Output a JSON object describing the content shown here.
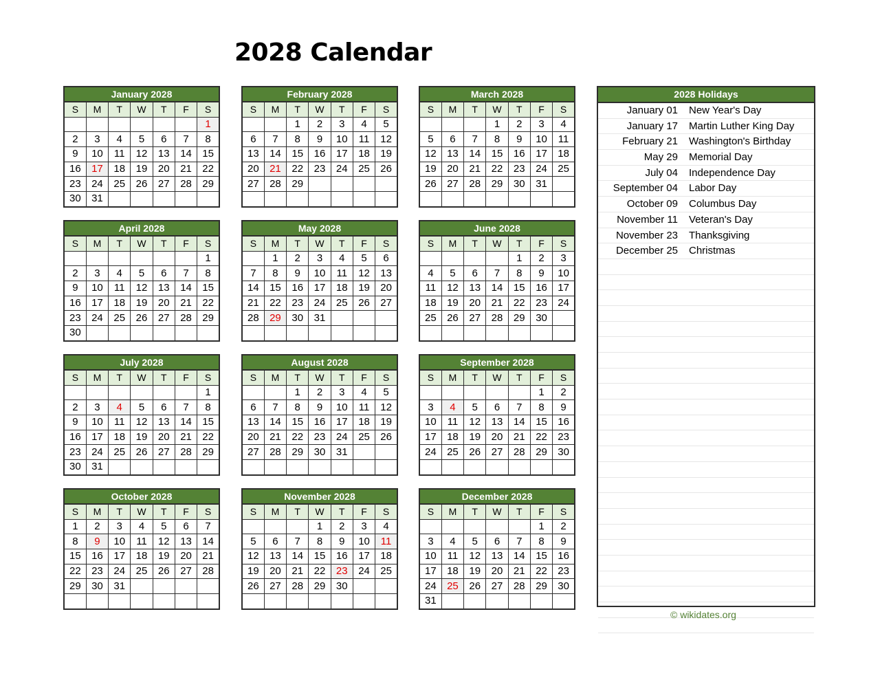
{
  "title": "2028 Calendar",
  "weekdays": [
    "S",
    "M",
    "T",
    "W",
    "T",
    "F",
    "S"
  ],
  "colors": {
    "header_green": "#548235",
    "weekday_bg": "#e2efda",
    "holiday_red": "#e00000",
    "holiday_bg": "#f0f0f0"
  },
  "months": [
    {
      "name": "January 2028",
      "start": 6,
      "days": 31,
      "holidays": [
        1,
        17
      ]
    },
    {
      "name": "February 2028",
      "start": 2,
      "days": 29,
      "holidays": [
        21
      ]
    },
    {
      "name": "March 2028",
      "start": 3,
      "days": 31,
      "holidays": []
    },
    {
      "name": "April 2028",
      "start": 6,
      "days": 30,
      "holidays": []
    },
    {
      "name": "May 2028",
      "start": 1,
      "days": 31,
      "holidays": [
        29
      ]
    },
    {
      "name": "June 2028",
      "start": 4,
      "days": 30,
      "holidays": []
    },
    {
      "name": "July 2028",
      "start": 6,
      "days": 31,
      "holidays": [
        4
      ]
    },
    {
      "name": "August 2028",
      "start": 2,
      "days": 31,
      "holidays": []
    },
    {
      "name": "September 2028",
      "start": 5,
      "days": 30,
      "holidays": [
        4
      ]
    },
    {
      "name": "October 2028",
      "start": 0,
      "days": 31,
      "holidays": [
        9
      ]
    },
    {
      "name": "November 2028",
      "start": 3,
      "days": 30,
      "holidays": [
        11,
        23
      ]
    },
    {
      "name": "December 2028",
      "start": 5,
      "days": 31,
      "holidays": [
        25
      ]
    }
  ],
  "holidays_panel": {
    "title": "2028 Holidays",
    "items": [
      {
        "date": "January 01",
        "name": "New Year's Day"
      },
      {
        "date": "January 17",
        "name": "Martin Luther King Day"
      },
      {
        "date": "February 21",
        "name": "Washington's Birthday"
      },
      {
        "date": "May 29",
        "name": "Memorial Day"
      },
      {
        "date": "July 04",
        "name": "Independence Day"
      },
      {
        "date": "September 04",
        "name": "Labor Day"
      },
      {
        "date": "October 09",
        "name": "Columbus Day"
      },
      {
        "date": "November 11",
        "name": "Veteran's Day"
      },
      {
        "date": "November 23",
        "name": "Thanksgiving"
      },
      {
        "date": "December 25",
        "name": "Christmas"
      }
    ]
  },
  "footer": "© wikidates.org"
}
